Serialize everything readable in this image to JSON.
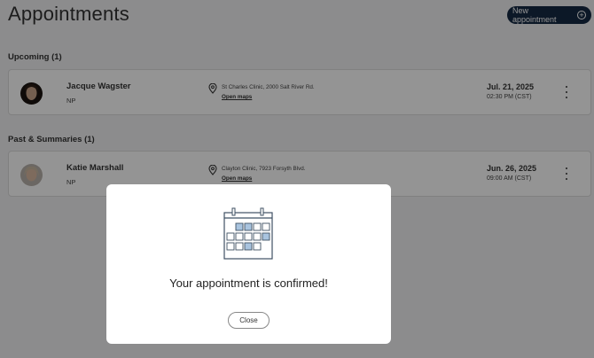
{
  "page": {
    "title": "Appointments",
    "new_button": "New appointment",
    "plus_icon": "⊕"
  },
  "sections": {
    "upcoming": "Upcoming (1)",
    "past": "Past & Summaries (1)"
  },
  "appointments": [
    {
      "name": "Jacque Wagster",
      "role": "NP",
      "address": "St Charles Clinic, 2000 Salt River Rd.",
      "maps": "Open maps",
      "date": "Jul. 21, 2025",
      "time": "02:30 PM (CST)"
    },
    {
      "name": "Katie Marshall",
      "role": "NP",
      "address": "Clayton Clinic, 7923 Forsyth Blvd.",
      "maps": "Open maps",
      "date": "Jun. 26, 2025",
      "time": "09:00 AM (CST)"
    }
  ],
  "modal": {
    "message": "Your appointment is confirmed!",
    "close_label": "Close"
  },
  "colors": {
    "primary": "#162a44",
    "calendar_highlight": "#a9c4df",
    "calendar_stroke": "#3f5063"
  }
}
